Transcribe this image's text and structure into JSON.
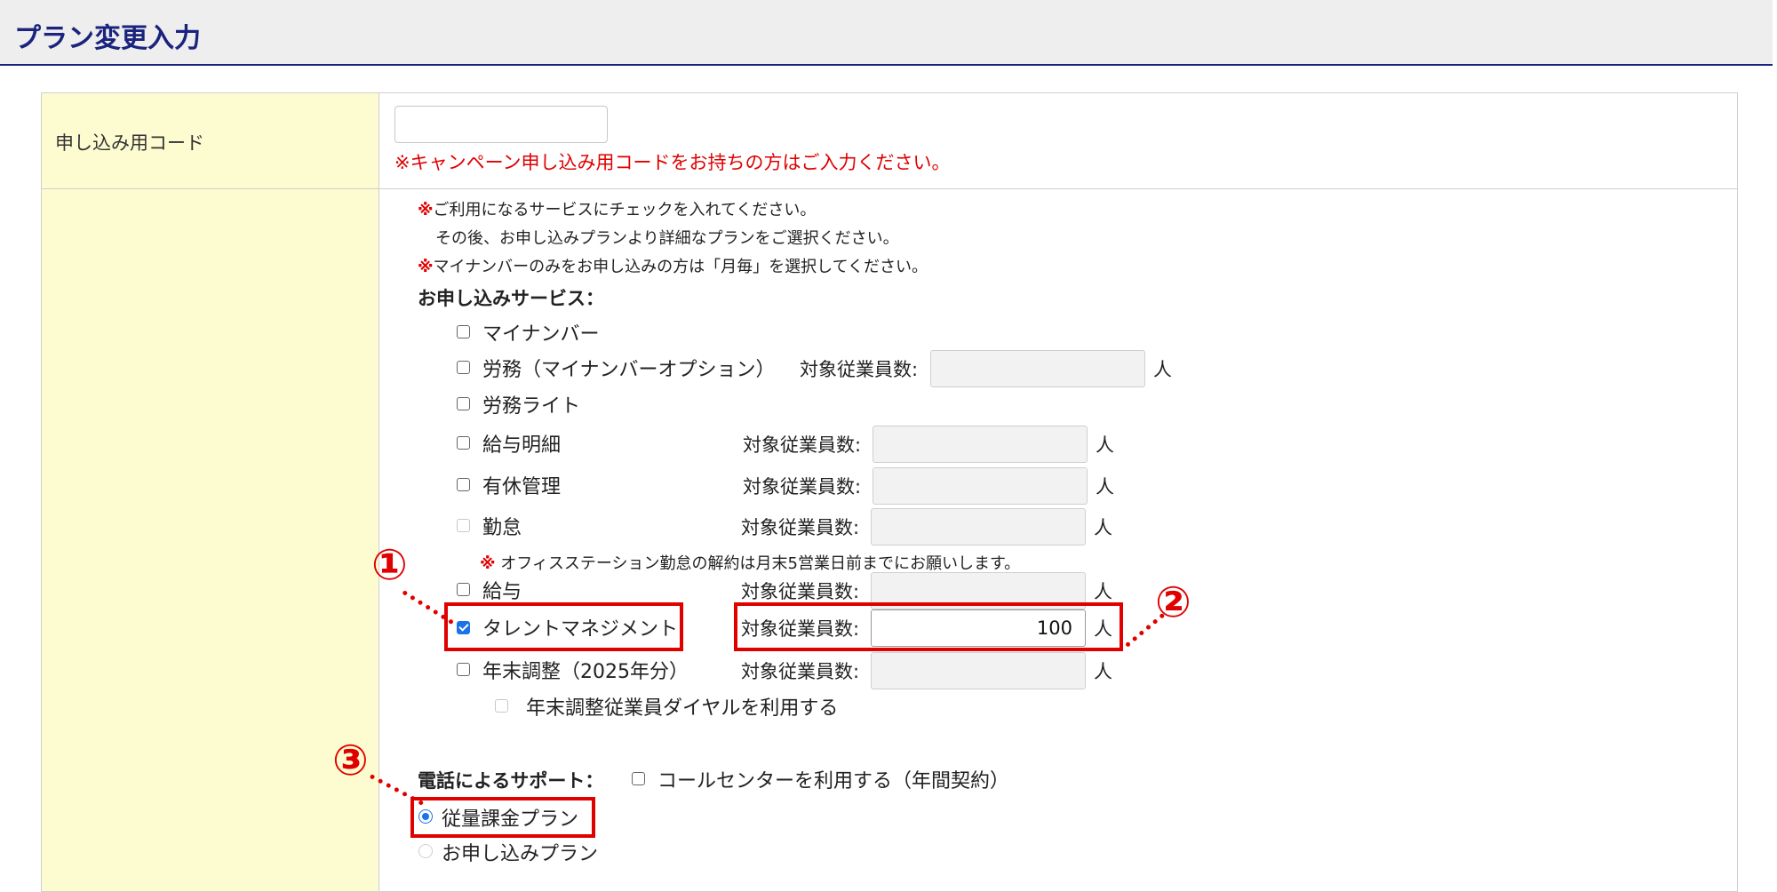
{
  "page_title": "プラン変更入力",
  "code_row": {
    "label": "申し込み用コード",
    "input_value": "",
    "note": "※キャンペーン申し込み用コードをお持ちの方はご入力ください。"
  },
  "notes": {
    "mark": "※",
    "line1": "ご利用になるサービスにチェックを入れてください。",
    "line2": "その後、お申し込みプランより詳細なプランをご選択ください。",
    "line3": "マイナンバーのみをお申し込みの方は「月毎」を選択してください。"
  },
  "services_label": "お申し込みサービス：",
  "count_label": "対象従業員数:",
  "unit": "人",
  "services": [
    {
      "label": "マイナンバー",
      "checked": false
    },
    {
      "label": "労務（マイナンバーオプション）",
      "checked": false,
      "count": ""
    },
    {
      "label": "労務ライト",
      "checked": false
    },
    {
      "label": "給与明細",
      "checked": false,
      "count": ""
    },
    {
      "label": "有休管理",
      "checked": false,
      "count": ""
    },
    {
      "label": "勤怠",
      "checked": false,
      "disabled": true,
      "count": ""
    },
    {
      "label": "給与",
      "checked": false,
      "count": ""
    },
    {
      "label": "タレントマネジメント",
      "checked": true,
      "count": "100"
    },
    {
      "label": "年末調整（2025年分）",
      "checked": false,
      "count": ""
    }
  ],
  "attendance_note": "オフィスステーション勤怠の解約は月末5営業日前までにお願いします。",
  "year_end_dial_label": "年末調整従業員ダイヤルを利用する",
  "phone_support": {
    "label": "電話によるサポート：",
    "option_label": "コールセンターを利用する（年間契約）",
    "checked": false
  },
  "plans": [
    {
      "label": "従量課金プラン",
      "selected": true
    },
    {
      "label": "お申し込みプラン",
      "selected": false
    }
  ],
  "annotations": [
    "①",
    "②",
    "③"
  ],
  "colors": {
    "header_title": "#1a237e",
    "label_column_bg": "#fdfcd0",
    "warning_red": "#e00000",
    "accent_blue": "#1a73e8"
  }
}
